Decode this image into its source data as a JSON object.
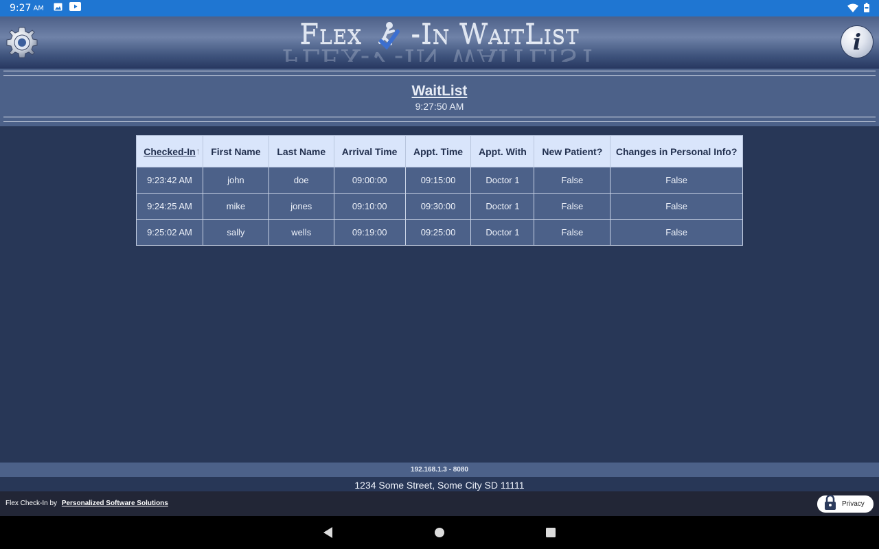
{
  "status_bar": {
    "time": "9:27",
    "ampm": "AM"
  },
  "header": {
    "logo_text": "FLEX-✓-IN WAITLIST",
    "logo_part1": "Flex",
    "logo_part2": "-In WaitList"
  },
  "page": {
    "title": "WaitList",
    "current_time": "9:27:50 AM"
  },
  "table": {
    "headers": [
      "Checked-In",
      "First Name",
      "Last Name",
      "Arrival Time",
      "Appt. Time",
      "Appt. With",
      "New Patient?",
      "Changes in Personal Info?"
    ],
    "sort_arrow": "↑",
    "rows": [
      [
        "9:23:42 AM",
        "john",
        "doe",
        "09:00:00",
        "09:15:00",
        "Doctor 1",
        "False",
        "False"
      ],
      [
        "9:24:25 AM",
        "mike",
        "jones",
        "09:10:00",
        "09:30:00",
        "Doctor 1",
        "False",
        "False"
      ],
      [
        "9:25:02 AM",
        "sally",
        "wells",
        "09:19:00",
        "09:25:00",
        "Doctor 1",
        "False",
        "False"
      ]
    ]
  },
  "footer": {
    "server": "192.168.1.3 - 8080",
    "address": "1234 Some Street, Some City SD 11111",
    "credits_prefix": "Flex Check-In by",
    "credits_link": "Personalized Software Solutions",
    "privacy_label": "Privacy"
  },
  "colors": {
    "status_bar": "#1f76d2",
    "background": "#283757",
    "band": "#4c6189",
    "table_header": "#d9e5fb"
  }
}
